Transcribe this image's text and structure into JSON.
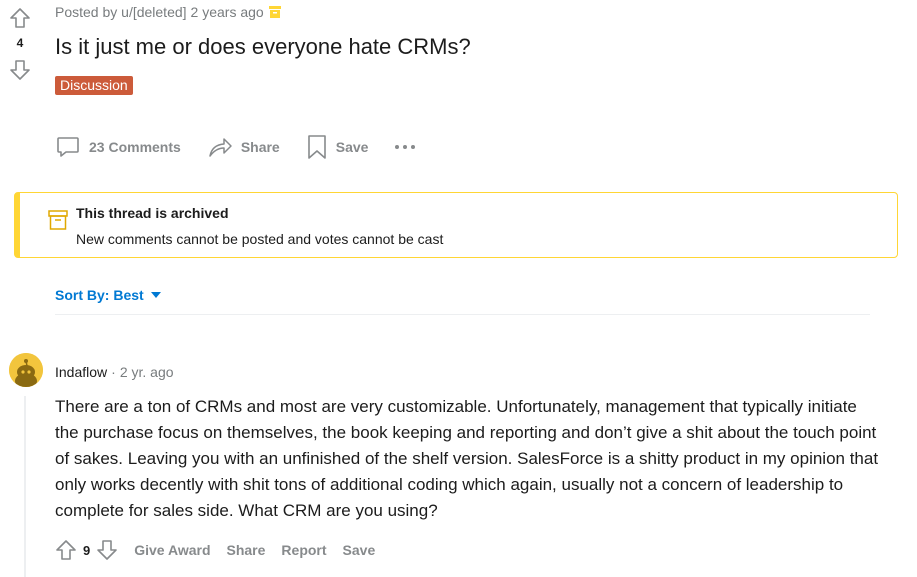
{
  "post": {
    "score": "4",
    "posted_by": "Posted by u/[deleted]",
    "time": "2 years ago",
    "title": "Is it just me or does everyone hate CRMs?",
    "flair": "Discussion",
    "flair_color": "#cc5b3a",
    "actions": {
      "comments": "23 Comments",
      "share": "Share",
      "save": "Save"
    }
  },
  "archived": {
    "title": "This thread is archived",
    "subtitle": "New comments cannot be posted and votes cannot be cast",
    "border_color": "#ffd635"
  },
  "sort": {
    "label": "Sort By: Best"
  },
  "comment": {
    "author": "Indaflow",
    "separator": "·",
    "time": "2 yr. ago",
    "body": "There are a ton of CRMs and most are very customizable. Unfortunately, management that typically initiate the purchase focus on themselves, the book keeping and reporting and don’t give a shit about the touch point of sakes. Leaving you with an unfinished of the shelf version. SalesForce is a shitty product in my opinion that only works decently with shit tons of additional coding which again, usually not a concern of leadership to complete for sales side. What CRM are you using?",
    "score": "9",
    "actions": {
      "give_award": "Give Award",
      "share": "Share",
      "report": "Report",
      "save": "Save"
    }
  },
  "colors": {
    "accent_blue": "#0079d3",
    "muted": "#878a8c"
  }
}
